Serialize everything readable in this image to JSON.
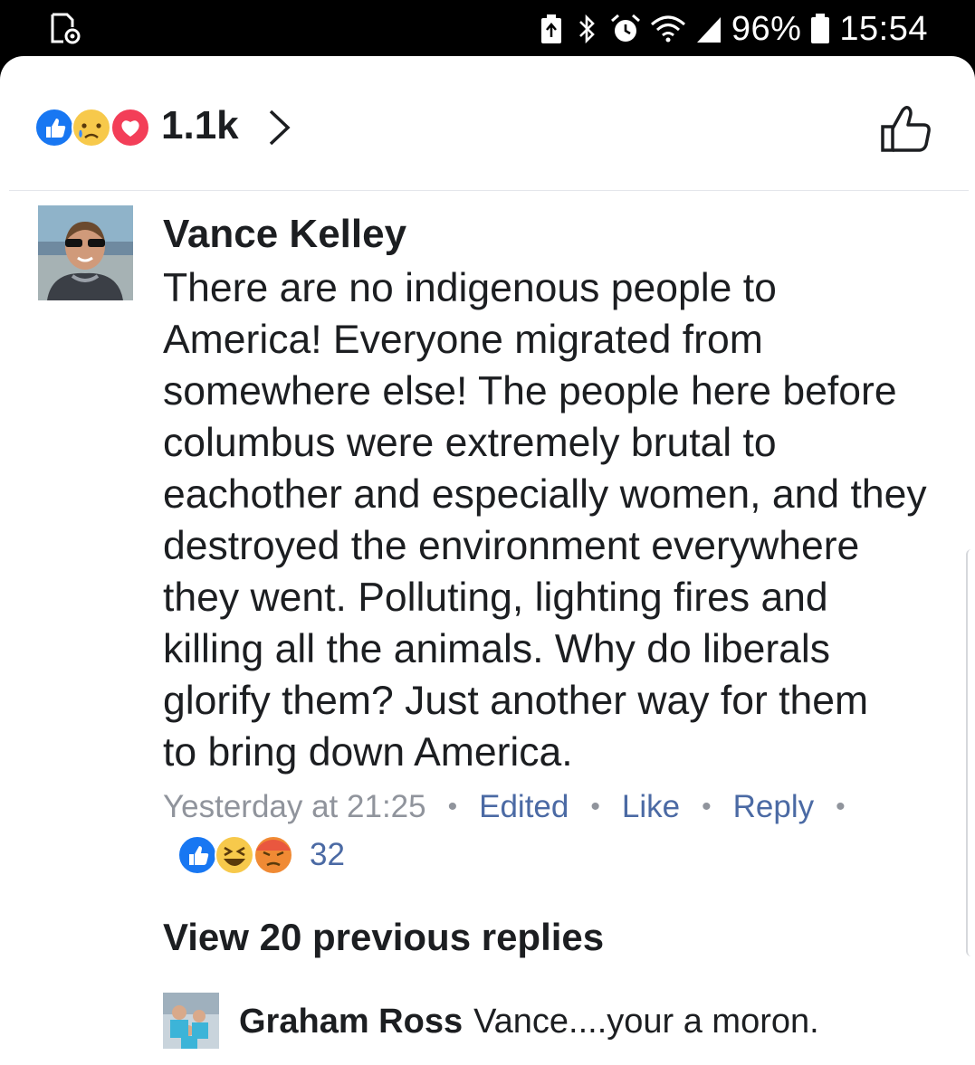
{
  "status_bar": {
    "battery_percent": "96%",
    "time": "15:54",
    "icons": [
      "screenshot-icon",
      "battery-saver-icon",
      "bluetooth-icon",
      "alarm-icon",
      "wifi-icon",
      "signal-icon",
      "battery-icon"
    ]
  },
  "reactions_header": {
    "count": "1.1k",
    "icons": [
      "like-reaction-icon",
      "sad-reaction-icon",
      "love-reaction-icon"
    ]
  },
  "comment": {
    "author": "Vance Kelley",
    "text": "There are no indigenous people to\nAmerica!  Everyone migrated from\nsomewhere else!  The people here before\ncolumbus were extremely brutal to\neachother and especially women, and they\ndestroyed the environment everywhere\nthey went.  Polluting, lighting fires and\nkilling all the animals.  Why do liberals\nglorify them?  Just another way for them\nto bring down America.",
    "timestamp": "Yesterday at 21:25",
    "edited_label": "Edited",
    "like_label": "Like",
    "reply_label": "Reply",
    "reaction_count": "32",
    "reaction_icons": [
      "like-reaction-icon",
      "haha-reaction-icon",
      "angry-reaction-icon"
    ]
  },
  "replies": {
    "view_previous_label": "View 20 previous replies",
    "latest": {
      "author": "Graham Ross",
      "text": "Vance....your a moron."
    }
  },
  "colors": {
    "like_blue": "#1877f2",
    "love_red": "#f33e58",
    "emoji_yellow": "#f7c94b",
    "link": "#4b6aa4",
    "meta_gray": "#90949c",
    "text": "#1c1e21"
  }
}
